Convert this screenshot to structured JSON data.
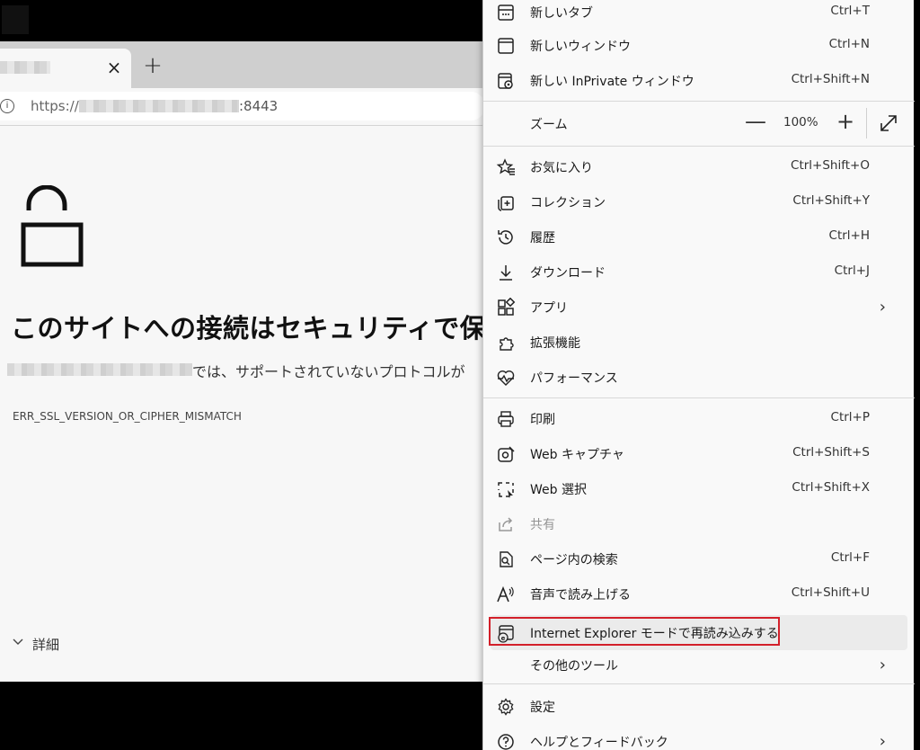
{
  "browser": {
    "tab": {
      "close_icon": "×",
      "new_tab_icon": "+"
    },
    "address": {
      "info_icon": "i",
      "url_prefix": "https://",
      "url_port": ":8443"
    }
  },
  "error_page": {
    "heading": "このサイトへの接続はセキュリティで保",
    "description": "では、サポートされていないプロトコルが",
    "error_code": "ERR_SSL_VERSION_OR_CIPHER_MISMATCH",
    "details_label": "詳細"
  },
  "menu": {
    "items": [
      {
        "name": "new-tab",
        "icon": "new-tab-icon",
        "label": "新しいタブ",
        "shortcut": "Ctrl+T"
      },
      {
        "name": "new-window",
        "icon": "window-icon",
        "label": "新しいウィンドウ",
        "shortcut": "Ctrl+N"
      },
      {
        "name": "new-inprivate",
        "icon": "inprivate-icon",
        "label": "新しい InPrivate ウィンドウ",
        "shortcut": "Ctrl+Shift+N"
      },
      {
        "name": "favorites",
        "icon": "favorites-icon",
        "label": "お気に入り",
        "shortcut": "Ctrl+Shift+O"
      },
      {
        "name": "collections",
        "icon": "collections-icon",
        "label": "コレクション",
        "shortcut": "Ctrl+Shift+Y"
      },
      {
        "name": "history",
        "icon": "history-icon",
        "label": "履歴",
        "shortcut": "Ctrl+H"
      },
      {
        "name": "downloads",
        "icon": "download-icon",
        "label": "ダウンロード",
        "shortcut": "Ctrl+J"
      },
      {
        "name": "apps",
        "icon": "apps-icon",
        "label": "アプリ",
        "arrow": "›"
      },
      {
        "name": "extensions",
        "icon": "puzzle-icon",
        "label": "拡張機能"
      },
      {
        "name": "performance",
        "icon": "heartbeat-icon",
        "label": "パフォーマンス"
      },
      {
        "name": "print",
        "icon": "printer-icon",
        "label": "印刷",
        "shortcut": "Ctrl+P"
      },
      {
        "name": "web-capture",
        "icon": "camera-capture-icon",
        "label": "Web キャプチャ",
        "shortcut": "Ctrl+Shift+S"
      },
      {
        "name": "web-select",
        "icon": "select-area-icon",
        "label": "Web 選択",
        "shortcut": "Ctrl+Shift+X"
      },
      {
        "name": "share",
        "icon": "share-icon",
        "label": "共有"
      },
      {
        "name": "find-on-page",
        "icon": "find-icon",
        "label": "ページ内の検索",
        "shortcut": "Ctrl+F"
      },
      {
        "name": "read-aloud",
        "icon": "read-aloud-icon",
        "label": "音声で読み上げる",
        "shortcut": "Ctrl+Shift+U"
      },
      {
        "name": "ie-mode",
        "icon": "ie-mode-icon",
        "label": "Internet Explorer モードで再読み込みする"
      },
      {
        "name": "more-tools",
        "icon": "",
        "label": "その他のツール",
        "arrow": "›"
      },
      {
        "name": "settings",
        "icon": "gear-icon",
        "label": "設定"
      },
      {
        "name": "help-feedback",
        "icon": "help-icon",
        "label": "ヘルプとフィードバック",
        "arrow": "›"
      }
    ],
    "zoom": {
      "label": "ズーム",
      "minus": "—",
      "value": "100%",
      "plus": "+"
    }
  },
  "colors": {
    "highlight_box": "#d3202a",
    "menu_bg": "#f9f9f9",
    "page_bg": "#f7f7f7"
  }
}
